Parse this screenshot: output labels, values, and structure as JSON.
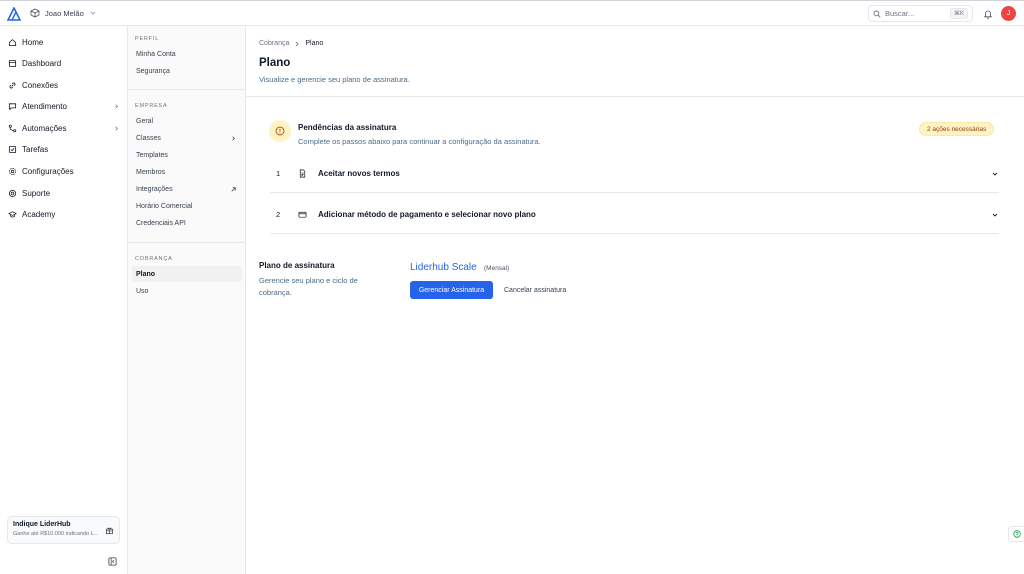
{
  "topbar": {
    "workspace_name": "Joao Melão",
    "search_placeholder": "Buscar...",
    "search_shortcut": "⌘K",
    "avatar_initial": "J"
  },
  "leftnav": {
    "items": [
      {
        "label": "Home",
        "icon": "home-icon"
      },
      {
        "label": "Dashboard",
        "icon": "dashboard-icon"
      },
      {
        "label": "Conexões",
        "icon": "link-icon"
      },
      {
        "label": "Atendimento",
        "icon": "chat-icon",
        "has_arrow": true
      },
      {
        "label": "Automações",
        "icon": "workflow-icon",
        "has_arrow": true
      },
      {
        "label": "Tarefas",
        "icon": "checkbox-icon"
      },
      {
        "label": "Configurações",
        "icon": "gear-icon"
      },
      {
        "label": "Suporte",
        "icon": "lifebuoy-icon"
      },
      {
        "label": "Academy",
        "icon": "academy-icon"
      }
    ],
    "promo": {
      "title": "Indique LiderHub",
      "subtitle": "Ganhe até R$10.000 indicando L..."
    }
  },
  "subnav": {
    "perfil_label": "PERFIL",
    "perfil_items": [
      "Minha Conta",
      "Segurança"
    ],
    "empresa_label": "EMPRESA",
    "empresa_items": [
      "Geral",
      "Classes",
      "Templates",
      "Membros",
      "Integrações",
      "Horário Comercial",
      "Credenciais API"
    ],
    "cobranca_label": "COBRANÇA",
    "cobranca_items": [
      "Plano",
      "Uso"
    ],
    "active": "Plano"
  },
  "main": {
    "breadcrumb": [
      "Cobrança",
      "Plano"
    ],
    "title": "Plano",
    "subtitle": "Visualize e gerencie seu plano de assinatura.",
    "pending": {
      "title": "Pendências da assinatura",
      "subtitle": "Complete os passos abaixo para continuar a configuração da assinatura.",
      "badge": "2 ações necessárias",
      "steps": [
        {
          "num": "1",
          "label": "Aceitar novos termos",
          "icon": "document-icon"
        },
        {
          "num": "2",
          "label": "Adicionar método de pagamento e selecionar novo plano",
          "icon": "credit-card-icon"
        }
      ]
    },
    "plan": {
      "label": "Plano de assinatura",
      "description": "Gerencie seu plano e ciclo de cobrança.",
      "name": "Liderhub Scale",
      "period": "(Mensal)",
      "manage_button": "Gerenciar Assinatura",
      "cancel_button": "Cancelar assinatura"
    }
  },
  "colors": {
    "accent": "#2563eb",
    "warning_bg": "#fdf3c4",
    "avatar": "#ef4444"
  }
}
